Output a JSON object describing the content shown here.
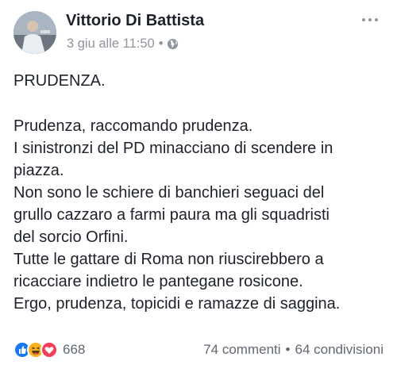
{
  "post": {
    "author": "Vittorio Di Battista",
    "timestamp": "3 giu alle 11:50",
    "separator": "•",
    "privacy_icon": "globe-icon",
    "title": "PRUDENZA.",
    "lines": [
      "Prudenza, raccomando prudenza.",
      "I sinistronzi del PD minacciano di scendere in",
      "piazza.",
      "Non sono le schiere di banchieri seguaci del",
      "grullo cazzaro a farmi paura ma gli squadristi",
      "del sorcio Orfini.",
      "Tutte le gattare di Roma non riuscirebbero a",
      "ricacciare indietro le pantegane rosicone.",
      "Ergo, prudenza, topicidi e ramazze di saggina."
    ]
  },
  "footer": {
    "reactions": [
      "like",
      "haha",
      "love"
    ],
    "reaction_count": "668",
    "comments": "74 commenti",
    "separator": "•",
    "shares": "64 condivisioni"
  },
  "colors": {
    "like": "#1877f2",
    "haha": "#f7b125",
    "love": "#f33e58",
    "meta": "#90949c"
  }
}
